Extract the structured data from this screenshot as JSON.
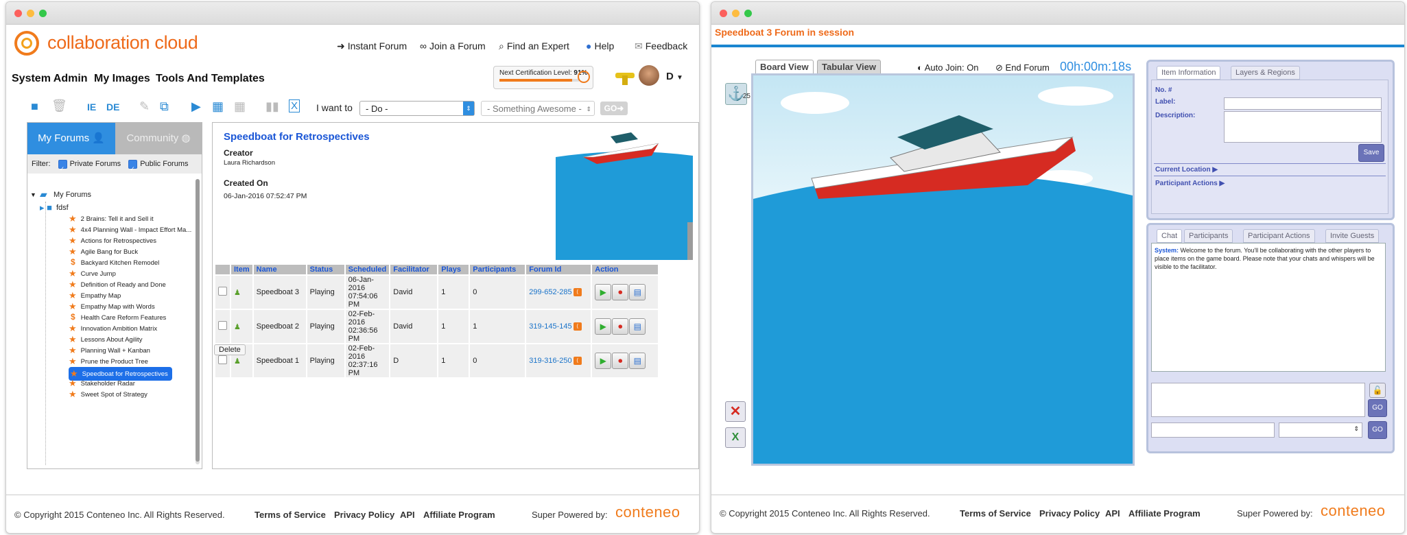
{
  "left": {
    "brand": "collaboration cloud",
    "topnav": [
      "Instant Forum",
      "Join a Forum",
      "Find an Expert",
      "Help",
      "Feedback"
    ],
    "menu": [
      "System Admin",
      "My Images",
      "Tools And Templates"
    ],
    "cert": {
      "label": "Next Certification Level:",
      "value": "91%",
      "progress": 0.91
    },
    "user_initial": "D",
    "toolbar": {
      "ie": "IE",
      "de": "DE",
      "i_want_to": "I want to",
      "do_select": "- Do -",
      "something_select": "- Something Awesome -",
      "go": "GO"
    },
    "tabs": {
      "my_forums": "My Forums",
      "community": "Community"
    },
    "filter": {
      "label": "Filter:",
      "private": "Private Forums",
      "public": "Public Forums"
    },
    "tree_root": "My Forums",
    "tree": [
      {
        "label": "fdsf",
        "kind": "folder"
      },
      {
        "label": "2 Brains: Tell it and Sell it",
        "kind": "star"
      },
      {
        "label": "4x4 Planning Wall - Impact Effort Ma...",
        "kind": "star"
      },
      {
        "label": "Actions for Retrospectives",
        "kind": "star"
      },
      {
        "label": "Agile Bang for Buck",
        "kind": "star"
      },
      {
        "label": "Backyard Kitchen Remodel",
        "kind": "dollar"
      },
      {
        "label": "Curve Jump",
        "kind": "star"
      },
      {
        "label": "Definition of Ready and Done",
        "kind": "star"
      },
      {
        "label": "Empathy Map",
        "kind": "star"
      },
      {
        "label": "Empathy Map with Words",
        "kind": "star"
      },
      {
        "label": "Health Care Reform Features",
        "kind": "dollar"
      },
      {
        "label": "Innovation Ambition Matrix",
        "kind": "star"
      },
      {
        "label": "Lessons About Agility",
        "kind": "star"
      },
      {
        "label": "Planning Wall + Kanban",
        "kind": "star"
      },
      {
        "label": "Prune the Product Tree",
        "kind": "star"
      },
      {
        "label": "Speedboat for Retrospectives",
        "kind": "star",
        "selected": true
      },
      {
        "label": "Stakeholder Radar",
        "kind": "star"
      },
      {
        "label": "Sweet Spot of Strategy",
        "kind": "star"
      }
    ],
    "detail": {
      "title": "Speedboat for Retrospectives",
      "creator_label": "Creator",
      "creator": "Laura Richardson",
      "created_label": "Created On",
      "created": "06-Jan-2016 07:52:47 PM"
    },
    "table": {
      "headers": [
        "Item",
        "Name",
        "Status",
        "Scheduled",
        "Facilitator",
        "Plays",
        "Participants",
        "Forum Id",
        "Action"
      ],
      "rows": [
        {
          "name": "Speedboat 3",
          "status": "Playing",
          "sched1": "06-Jan-2016",
          "sched2": "07:54:06 PM",
          "facilitator": "David",
          "plays": "1",
          "participants": "0",
          "forum_id": "299-652-285"
        },
        {
          "name": "Speedboat 2",
          "status": "Playing",
          "sched1": "02-Feb-2016",
          "sched2": "02:36:56 PM",
          "facilitator": "David",
          "plays": "1",
          "participants": "1",
          "forum_id": "319-145-145"
        },
        {
          "name": "Speedboat 1",
          "status": "Playing",
          "sched1": "02-Feb-2016",
          "sched2": "02:37:16 PM",
          "facilitator": "D",
          "plays": "1",
          "participants": "0",
          "forum_id": "319-316-250"
        }
      ],
      "delete": "Delete"
    },
    "footer": {
      "copyright": "© Copyright 2015 Conteneo Inc. All Rights Reserved.",
      "links": [
        "Terms of Service",
        "Privacy Policy",
        "API",
        "Affiliate Program"
      ],
      "powered": "Super Powered by:",
      "brand": "conteneo"
    }
  },
  "right": {
    "title": "Speedboat 3 Forum in session",
    "tabs": [
      "Board View",
      "Tabular View"
    ],
    "auto_join": "Auto Join: On",
    "end_forum": "End Forum",
    "timer": "00h:00m:18s",
    "anchor_count": "25",
    "item_tabs": [
      "Item Information",
      "Layers & Regions"
    ],
    "item_fields": {
      "no": "No. #",
      "label": "Label:",
      "description": "Description:",
      "save": "Save",
      "current_location": "Current Location",
      "participant_actions": "Participant Actions"
    },
    "chat_tabs": [
      "Chat",
      "Participants",
      "Participant Actions",
      "Invite Guests"
    ],
    "chat_system_label": "System:",
    "chat_message": "Welcome to the forum. You'll be collaborating with the other players to place items on the game board. Please note that your chats and whispers will be visible to the facilitator.",
    "go": "GO",
    "footer": {
      "copyright": "© Copyright 2015 Conteneo Inc. All Rights Reserved.",
      "links": [
        "Terms of Service",
        "Privacy Policy",
        "API",
        "Affiliate Program"
      ],
      "powered": "Super Powered by:",
      "brand": "conteneo"
    }
  },
  "colors": {
    "accent": "#ee6a1a",
    "blue": "#2f8ee0",
    "link": "#1a73c9"
  }
}
